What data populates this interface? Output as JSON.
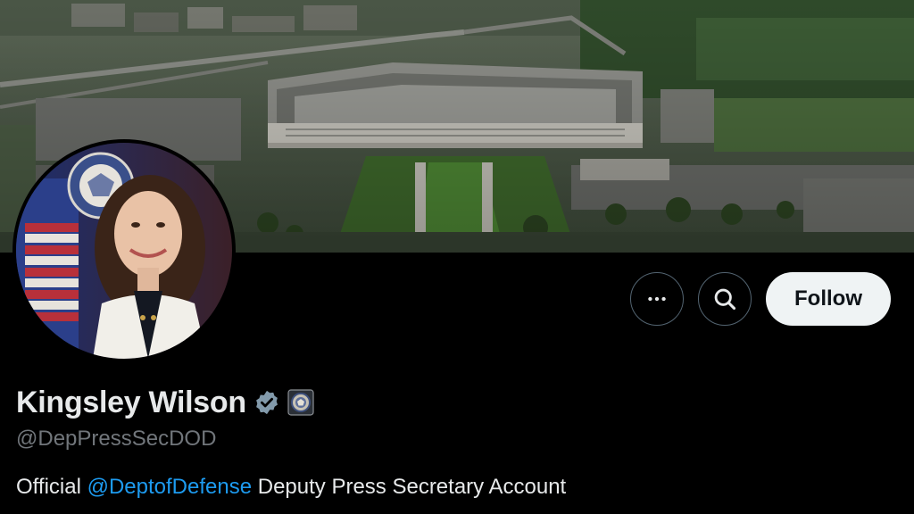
{
  "profile": {
    "display_name": "Kingsley Wilson",
    "handle": "@DepPressSecDOD",
    "bio": {
      "prefix": "Official ",
      "mention": "@DeptofDefense",
      "suffix": " Deputy Press Secretary Account"
    }
  },
  "actions": {
    "more_icon": "more-horizontal-icon",
    "search_icon": "search-icon",
    "follow_label": "Follow"
  },
  "badges": {
    "verified_icon": "verified-badge-icon",
    "verified_color": "#829aab",
    "affiliation_icon": "affiliation-seal-icon"
  },
  "colors": {
    "background": "#000000",
    "text_primary": "#e7e9ea",
    "text_secondary": "#71767b",
    "link": "#1d9bf0",
    "follow_bg": "#eff3f4",
    "follow_text": "#0f1419",
    "button_border": "#536471"
  },
  "images": {
    "banner": "aerial-photo-of-pentagon",
    "avatar": "profile-photo"
  }
}
